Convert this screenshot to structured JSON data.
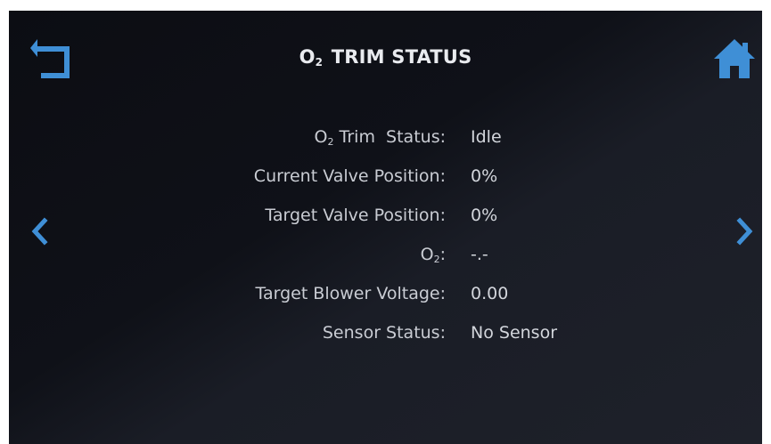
{
  "header": {
    "title_prefix": "O",
    "title_sub": "2",
    "title_rest": " TRIM STATUS",
    "back_icon": "back-arrow-icon",
    "home_icon": "home-icon"
  },
  "nav": {
    "prev_icon": "chevron-left-icon",
    "next_icon": "chevron-right-icon"
  },
  "status": {
    "o2_trim_status": {
      "label_prefix": "O",
      "label_sub": "2",
      "label_rest": " Trim  Status:",
      "value": "Idle"
    },
    "current_valve_position": {
      "label": "Current Valve Position:",
      "value": "0%"
    },
    "target_valve_position": {
      "label": "Target Valve Position:",
      "value": "0%"
    },
    "o2": {
      "label_prefix": "O",
      "label_sub": "2",
      "label_rest": ":",
      "value": "-.-"
    },
    "target_blower_voltage": {
      "label": "Target Blower Voltage:",
      "value": "0.00"
    },
    "sensor_status": {
      "label": "Sensor Status:",
      "value": "No Sensor"
    }
  },
  "colors": {
    "accent": "#3f8fd6",
    "text": "#c9ccd3",
    "title": "#e9ebef",
    "background": "#0f1118"
  }
}
